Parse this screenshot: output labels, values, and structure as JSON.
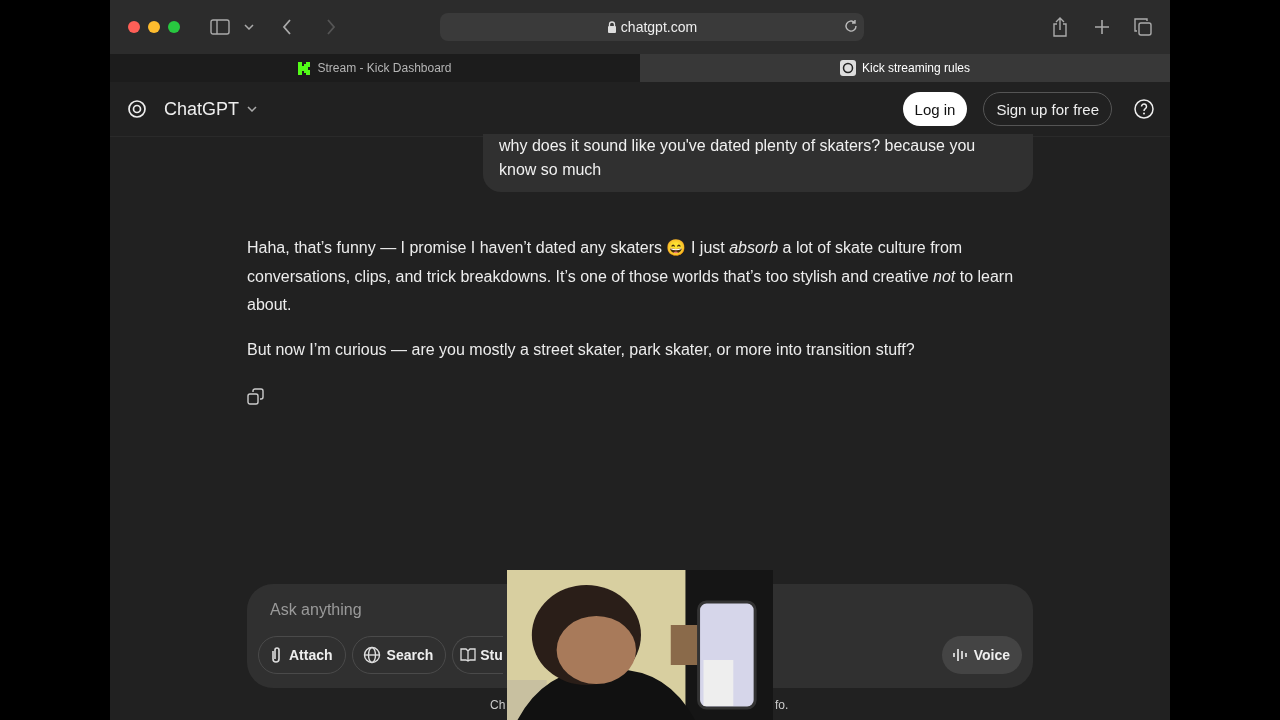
{
  "browser": {
    "address": "chatgpt.com",
    "tabs": [
      {
        "label": "Stream - Kick Dashboard",
        "selected": false
      },
      {
        "label": "Kick streaming rules",
        "selected": true
      }
    ]
  },
  "header": {
    "title": "ChatGPT",
    "buttons": [
      {
        "label": "Log in",
        "kind": "primary"
      },
      {
        "label": "Sign up for free",
        "kind": "outline"
      }
    ]
  },
  "user_message": "why does it sound like you've dated plenty of skaters? because you know so much",
  "reply": [
    "Haha, that’s funny — I promise I haven’t dated any skaters 😄 I just *absorb* a lot of skate culture from conversations, clips, and trick breakdowns. It’s one of those worlds that’s too stylish and creative *not* to learn about.",
    "But now I’m curious — are you mostly a street skater, park skater, or more into transition stuff?"
  ],
  "composer": {
    "placeholder": "Ask anything",
    "tools": [
      "Attach",
      "Search",
      "Stu"
    ],
    "voice": "Voice"
  },
  "footer": {
    "left": "Ch",
    "right": "fo."
  },
  "overlay": {
    "kind": "picture"
  }
}
